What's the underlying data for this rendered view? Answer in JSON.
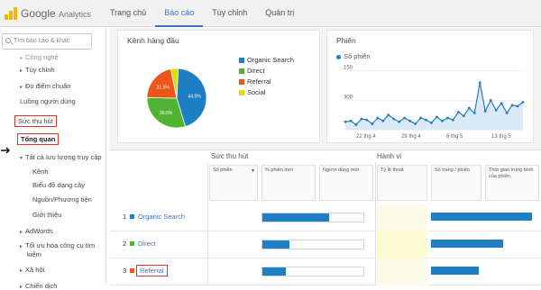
{
  "header": {
    "logo_brand": "Google",
    "logo_product": "Analytics",
    "nav": [
      "Trang chủ",
      "Báo cáo",
      "Tùy chỉnh",
      "Quản trị"
    ],
    "active_nav": "Báo cáo"
  },
  "sidebar": {
    "search_placeholder": "Tìm báo cáo & khác",
    "items": {
      "segments": "Công nghệ",
      "custom": "Tùy chỉnh",
      "benchmarks": "Đo điểm chuẩn",
      "user_flow": "Luồng người dùng",
      "acquisition": "Sức thu hút",
      "overview": "Tổng quan",
      "all_traffic": "Tất cả lưu lượng truy cập",
      "channels": "Kênh",
      "treemaps": "Biểu đồ dạng cây",
      "source_medium": "Nguồn/Phương tiện",
      "referrals": "Giới thiệu",
      "adwords": "AdWords",
      "seo_1": "Tối ưu hóa công cụ tìm",
      "seo_2": "kiếm",
      "social": "Xã hội",
      "campaigns": "Chiến dịch"
    }
  },
  "top_channels": {
    "title": "Kênh hàng đầu",
    "legend": [
      {
        "label": "Organic Search",
        "color": "#1f7fc4"
      },
      {
        "label": "Direct",
        "color": "#50b432"
      },
      {
        "label": "Referral",
        "color": "#ed561b"
      },
      {
        "label": "Social",
        "color": "#dddf00"
      }
    ],
    "pie_labels": [
      "44.5%",
      "30.0%",
      "21.5%"
    ]
  },
  "sessions": {
    "title": "Phiên",
    "legend": "Số phiên",
    "y_ticks": [
      "300",
      "150"
    ],
    "x_ticks": [
      "22 thg 4",
      "29 thg 4",
      "6 thg 5",
      "13 thg 5"
    ]
  },
  "chart_data": [
    {
      "type": "pie",
      "title": "Kênh hàng đầu",
      "categories": [
        "Organic Search",
        "Direct",
        "Referral",
        "Social"
      ],
      "values": [
        44.5,
        30.0,
        21.5,
        4.0
      ]
    },
    {
      "type": "line",
      "title": "Phiên",
      "series": [
        {
          "name": "Số phiên",
          "values": [
            40,
            45,
            25,
            55,
            50,
            30,
            60,
            45,
            75,
            55,
            40,
            60,
            45,
            30,
            60,
            50,
            35,
            65,
            45,
            60,
            50,
            90,
            70,
            110,
            85,
            240,
            95,
            150,
            100,
            135,
            85,
            125,
            120,
            140
          ]
        }
      ],
      "ylim": [
        0,
        340
      ],
      "y_ticks": [
        150,
        300
      ]
    }
  ],
  "table": {
    "groups": [
      "Sức thu hút",
      "Hành vi"
    ],
    "columns": [
      "Số phiên",
      "% phiên mới",
      "Người dùng mới",
      "Tỷ lệ thoát",
      "Số trang / phiên",
      "Thời gian trung bình của phiên"
    ],
    "rows": [
      {
        "index": "1",
        "name": "Organic Search",
        "color": "#1f7fc4",
        "pct_new": 0.66,
        "pages": 0.95
      },
      {
        "index": "2",
        "name": "Direct",
        "color": "#50b432",
        "pct_new": 0.27,
        "pages": 0.68
      },
      {
        "index": "3",
        "name": "Referral",
        "color": "#ed561b",
        "pct_new": 0.23,
        "pages": 0.45
      }
    ]
  }
}
